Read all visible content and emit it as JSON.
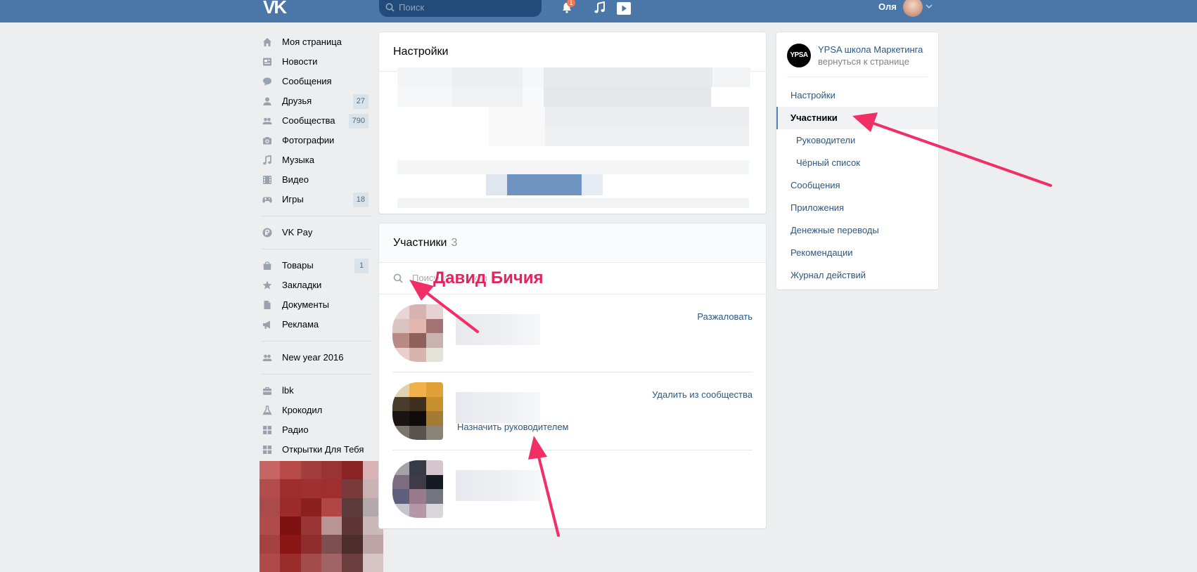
{
  "header": {
    "logo": "VK",
    "search_placeholder": "Поиск",
    "notification_count": "1",
    "user_name": "Оля"
  },
  "left_menu": {
    "group1": [
      {
        "label": "Моя страница",
        "icon": "home-icon"
      },
      {
        "label": "Новости",
        "icon": "news-icon"
      },
      {
        "label": "Сообщения",
        "icon": "messages-icon"
      },
      {
        "label": "Друзья",
        "icon": "friends-icon",
        "count": "27"
      },
      {
        "label": "Сообщества",
        "icon": "communities-icon",
        "count": "790"
      },
      {
        "label": "Фотографии",
        "icon": "camera-icon"
      },
      {
        "label": "Музыка",
        "icon": "music-icon"
      },
      {
        "label": "Видео",
        "icon": "video-icon"
      },
      {
        "label": "Игры",
        "icon": "gamepad-icon",
        "count": "18"
      }
    ],
    "group2": [
      {
        "label": "VK Pay",
        "icon": "vkpay-icon"
      }
    ],
    "group3": [
      {
        "label": "Товары",
        "icon": "bag-icon",
        "count": "1"
      },
      {
        "label": "Закладки",
        "icon": "star-icon"
      },
      {
        "label": "Документы",
        "icon": "document-icon"
      },
      {
        "label": "Реклама",
        "icon": "megaphone-icon"
      }
    ],
    "group4": [
      {
        "label": "New year 2016",
        "icon": "group-icon"
      }
    ],
    "group5": [
      {
        "label": "lbk",
        "icon": "briefcase-icon"
      },
      {
        "label": "Крокодил",
        "icon": "flask-icon"
      },
      {
        "label": "Радио",
        "icon": "apps-icon"
      },
      {
        "label": "Открытки Для Тебя",
        "icon": "apps-icon"
      }
    ]
  },
  "settings_card": {
    "title": "Настройки"
  },
  "members_card": {
    "title": "Участники",
    "count": "3",
    "search_placeholder": "Поиск участников",
    "annotation": "Давид Бичия",
    "rows": [
      {
        "action": "Разжаловать"
      },
      {
        "action": "Удалить из сообщества",
        "secondary_action": "Назначить руководителем"
      },
      {
        "action": ""
      }
    ]
  },
  "right_menu": {
    "group_name": "YPSA школа Маркетинга",
    "back_link": "вернуться к странице",
    "logo_text": "YPSA",
    "items": [
      {
        "label": "Настройки"
      },
      {
        "label": "Участники",
        "active": true
      },
      {
        "label": "Руководители",
        "sub": true
      },
      {
        "label": "Чёрный список",
        "sub": true
      },
      {
        "label": "Сообщения"
      },
      {
        "label": "Приложения"
      },
      {
        "label": "Денежные переводы"
      },
      {
        "label": "Рекомендации"
      },
      {
        "label": "Журнал действий"
      }
    ]
  },
  "colors": {
    "header_bg": "#4a76a8",
    "link": "#2a5885",
    "annotation": "#e3245d",
    "page_bg": "#edeef0"
  }
}
